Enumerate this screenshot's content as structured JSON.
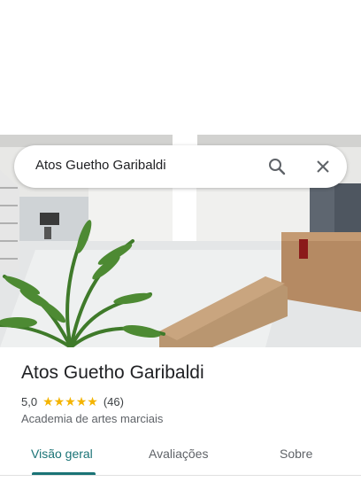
{
  "search": {
    "query": "Atos Guetho Garibaldi"
  },
  "place": {
    "name": "Atos Guetho Garibaldi",
    "rating": "5,0",
    "stars": "★★★★★",
    "review_count": "(46)",
    "category": "Academia de artes marciais"
  },
  "tabs": [
    {
      "label": "Visão geral",
      "active": true
    },
    {
      "label": "Avaliações",
      "active": false
    },
    {
      "label": "Sobre",
      "active": false
    }
  ],
  "colors": {
    "accent": "#1a7376",
    "star": "#f4b400"
  }
}
